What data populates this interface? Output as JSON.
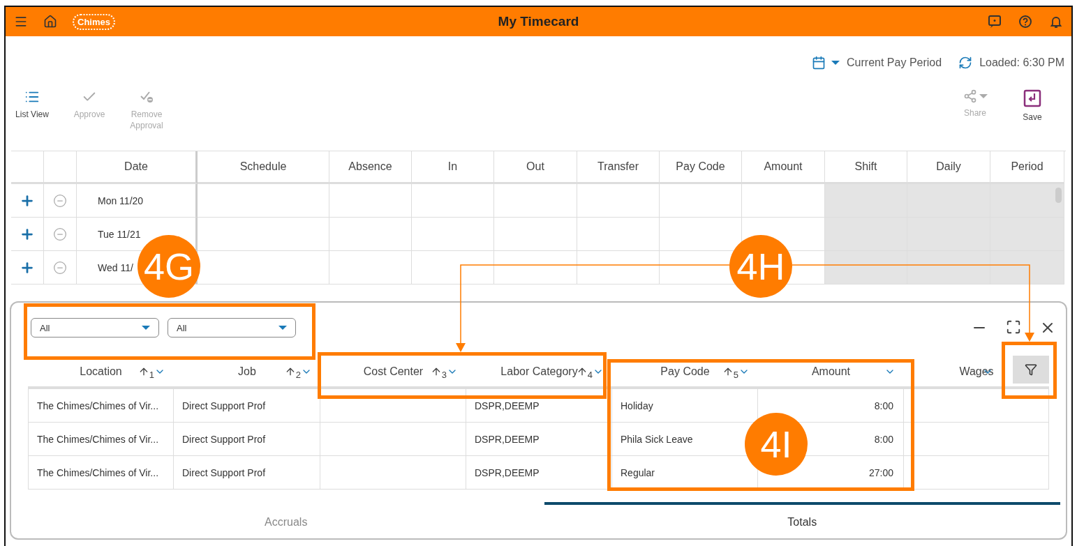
{
  "header": {
    "title": "My Timecard",
    "logo": "Chimes"
  },
  "period": {
    "label": "Current Pay Period",
    "loaded": "Loaded: 6:30 PM"
  },
  "toolbar_left": [
    {
      "label": "List View",
      "disabled": false
    },
    {
      "label": "Approve",
      "disabled": true
    },
    {
      "label": "Remove Approval",
      "disabled": true
    }
  ],
  "toolbar_right": [
    {
      "label": "Share",
      "disabled": true
    },
    {
      "label": "Save",
      "disabled": false
    }
  ],
  "timecard": {
    "columns": [
      {
        "label": "Date",
        "shaded": false
      },
      {
        "label": "Schedule",
        "shaded": false
      },
      {
        "label": "Absence",
        "shaded": false
      },
      {
        "label": "In",
        "shaded": false
      },
      {
        "label": "Out",
        "shaded": false
      },
      {
        "label": "Transfer",
        "shaded": false
      },
      {
        "label": "Pay Code",
        "shaded": false
      },
      {
        "label": "Amount",
        "shaded": false
      },
      {
        "label": "Shift",
        "shaded": true
      },
      {
        "label": "Daily",
        "shaded": true
      },
      {
        "label": "Period",
        "shaded": true
      }
    ],
    "rows": [
      {
        "date": "Mon 11/20"
      },
      {
        "date": "Tue 11/21"
      },
      {
        "date": "Wed 11/"
      }
    ]
  },
  "panel": {
    "filters": [
      {
        "value": "All"
      },
      {
        "value": "All"
      }
    ],
    "columns": [
      {
        "label": "Location",
        "sort": "1"
      },
      {
        "label": "Job",
        "sort": "2"
      },
      {
        "label": "Cost Center",
        "sort": "3"
      },
      {
        "label": "Labor Category",
        "sort": "4"
      },
      {
        "label": "Pay Code",
        "sort": "5"
      },
      {
        "label": "Amount"
      },
      {
        "label": "Wages"
      }
    ],
    "rows": [
      [
        "The Chimes/Chimes of Vir...",
        "Direct Support Prof",
        "",
        "DSPR,DEEMP",
        "Holiday",
        "8:00",
        ""
      ],
      [
        "The Chimes/Chimes of Vir...",
        "Direct Support Prof",
        "",
        "DSPR,DEEMP",
        "Phila Sick Leave",
        "8:00",
        ""
      ],
      [
        "The Chimes/Chimes of Vir...",
        "Direct Support Prof",
        "",
        "DSPR,DEEMP",
        "Regular",
        "27:00",
        ""
      ]
    ],
    "tabs": [
      {
        "label": "Accruals",
        "selected": false
      },
      {
        "label": "Totals",
        "selected": true
      }
    ]
  },
  "callouts": [
    {
      "label": "4G"
    },
    {
      "label": "4H"
    },
    {
      "label": "4I"
    }
  ]
}
